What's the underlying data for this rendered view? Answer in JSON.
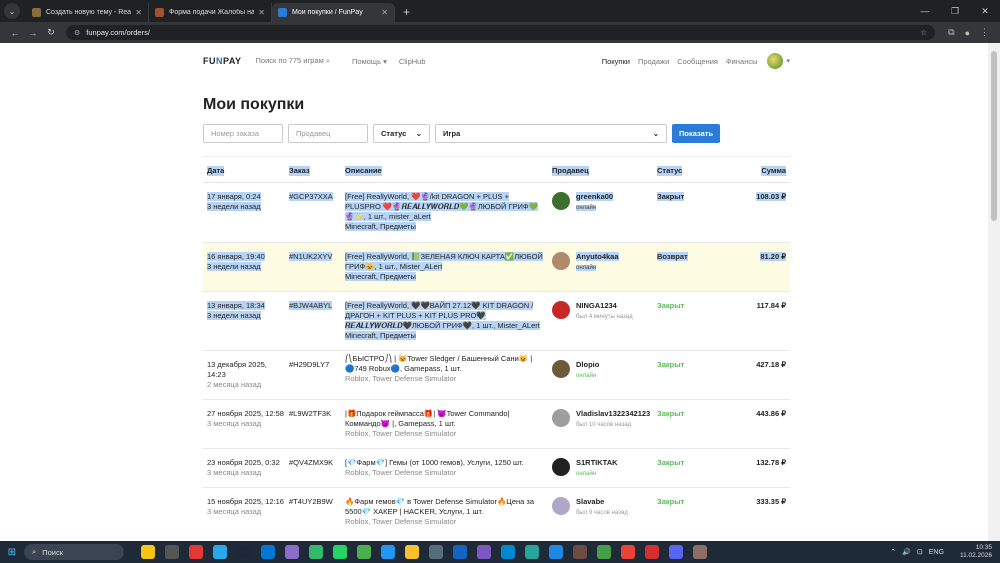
{
  "browser": {
    "tabs": [
      {
        "title": "Создать новую тему - ReallyW",
        "color": "#8a6d3b"
      },
      {
        "title": "Форма подачи Жалобы на Ад",
        "color": "#a0522d"
      },
      {
        "title": "Мои покупки / FunPay",
        "color": "#2b7bd8"
      }
    ],
    "url": "funpay.com/orders/"
  },
  "header": {
    "logo_left": "FU",
    "logo_accent": "N",
    "logo_right": "PAY",
    "search": "Поиск по 775 играм",
    "help": "Помощь",
    "cliphub": "ClipHub",
    "purchases": "Покупки",
    "sales": "Продажи",
    "messages": "Сообщения",
    "finance": "Финансы"
  },
  "page_title": "Мои покупки",
  "filters": {
    "order_placeholder": "Номер заказа",
    "seller_placeholder": "Продавец",
    "status": "Статус",
    "game": "Игра",
    "show": "Показать"
  },
  "columns": {
    "date": "Дата",
    "order": "Заказ",
    "desc": "Описание",
    "seller": "Продавец",
    "status": "Статус",
    "sum": "Сумма"
  },
  "orders": [
    {
      "d1": "17 января, 0:24",
      "d2": "3 недели назад",
      "id": "#GCP37XXA",
      "desc": "[Free] ReallyWorld, ❤️🔮/kit DRAGON + PLUS + PLUSPRO ❤️🔮𝑹𝑬𝑨𝑳𝑳𝒀𝑾𝑶𝑹𝑳𝑫💚🔮ЛЮБОЙ ГРИФ💚🔮✨, 1 шт., mister_aLert",
      "cat": "Minecraft, Предметы",
      "seller": "greenka00",
      "sub": "онлайн",
      "status": "Закрыт",
      "sum": "108.03 ₽"
    },
    {
      "d1": "16 января, 19:40",
      "d2": "3 недели назад",
      "id": "#N1UK2XYV",
      "desc": "[Free] ReallyWorld, 📗ЗЕЛЕНАЯ КЛЮЧ КАРТА✅ЛЮБОЙ ГРИФ😺, 1 шт., Mister_ALert",
      "cat": "Minecraft, Предметы",
      "seller": "Anyuto4kaa",
      "sub": "онлайн",
      "status": "Возврат",
      "sum": "81.20 ₽"
    },
    {
      "d1": "13 января, 18:34",
      "d2": "3 недели назад",
      "id": "#BJW4ABYL",
      "desc": "[Free] ReallyWorld, 🖤🖤ВАЙП 27.12🖤 KIT DRAGON / ДРАГОН + KIT PLUS + KIT PLUS PRO🖤 𝑹𝑬𝑨𝑳𝑳𝒀𝑾𝑶𝑹𝑳𝑫🖤ЛЮБОЙ ГРИФ🖤, 1 шт., Mister_ALert",
      "cat": "Minecraft, Предметы",
      "seller": "NINGA1234",
      "sub": "был 4 минуты назад",
      "status": "Закрыт",
      "sum": "117.84 ₽"
    },
    {
      "d1": "13 декабря 2025, 14:23",
      "d2": "2 месяца назад",
      "id": "#H29D9LY7",
      "desc": "⎛⎝БЫСТРО⎠⎞ | 😺Tower Sledger / Башенный Сани😺 | 🔵749 Robux🔵, Gamepass, 1 шт.",
      "cat": "Roblox, Tower Defense Simulator",
      "seller": "Dlopio",
      "sub": "онлайн",
      "status": "Закрыт",
      "sum": "427.18 ₽"
    },
    {
      "d1": "27 ноября 2025, 12:58",
      "d2": "3 месяца назад",
      "id": "#L9W2TF3K",
      "desc": "|🎁Подарок геймпасса🎁| 👿Tower Commando|Коммандо👿 |, Gamepass, 1 шт.",
      "cat": "Roblox, Tower Defense Simulator",
      "seller": "Vladislav1322342123",
      "sub": "был 10 часов назад",
      "status": "Закрыт",
      "sum": "443.86 ₽"
    },
    {
      "d1": "23 ноября 2025, 0:32",
      "d2": "3 месяца назад",
      "id": "#QV4ZMX9K",
      "desc": "[💎Фарм💎] Гемы (от 1000 гемов), Услуги, 1250 шт.",
      "cat": "Roblox, Tower Defense Simulator",
      "seller": "S1RTIKTAK",
      "sub": "онлайн",
      "status": "Закрыт",
      "sum": "132.78 ₽"
    },
    {
      "d1": "15 ноября 2025, 12:16",
      "d2": "3 месяца назад",
      "id": "#T4UY2B9W",
      "desc": "🔥Фарм гемов💎 в Tower Defense Simulator🔥Цена за 5500💎 ХАКЕР | HACKER, Услуги, 1 шт.",
      "cat": "Roblox, Tower Defense Simulator",
      "seller": "Slavabe",
      "sub": "был 9 часов назад",
      "status": "Закрыт",
      "sum": "333.35 ₽"
    }
  ],
  "taskbar": {
    "search": "Поиск",
    "lang": "ENG",
    "time": "10:35",
    "date": "11.02.2026"
  }
}
